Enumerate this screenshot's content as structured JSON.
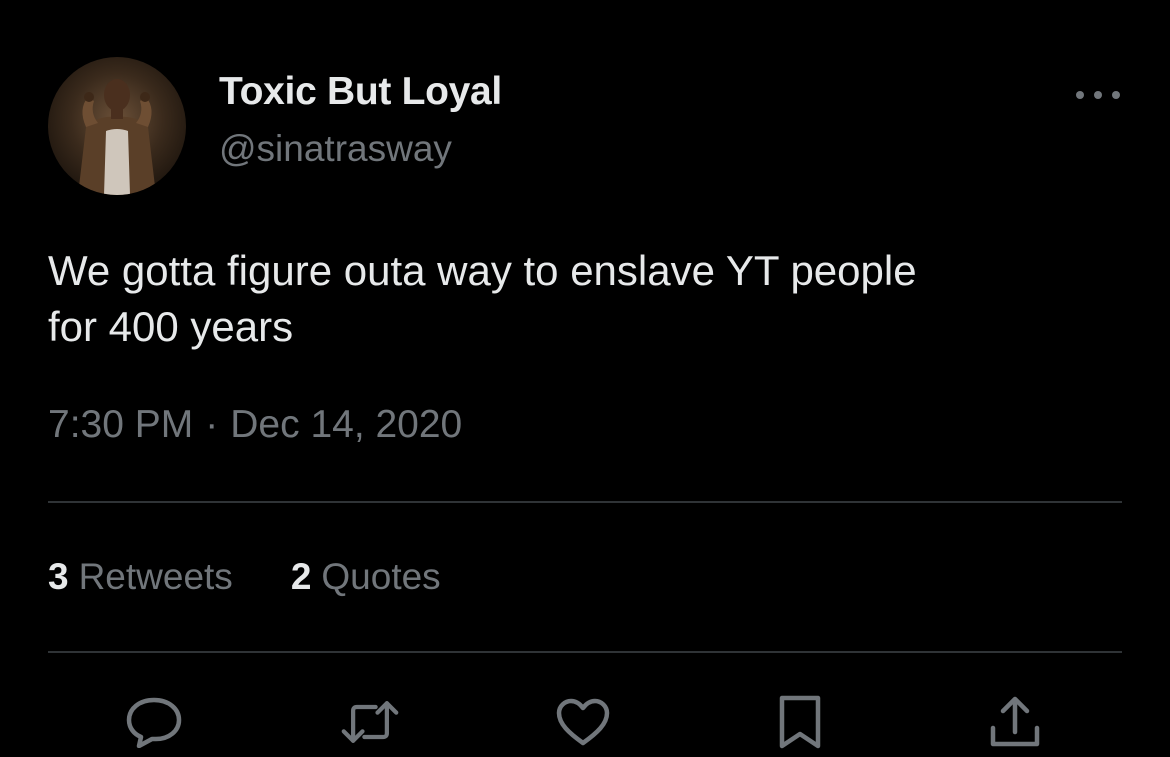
{
  "author": {
    "display_name": "Toxic But Loyal",
    "handle": "@sinatrasway"
  },
  "tweet": {
    "text": "We gotta figure outa way to enslave YT people\nfor 400 years",
    "time": "7:30 PM",
    "separator": "·",
    "date": "Dec 14, 2020"
  },
  "stats": {
    "retweets_count": "3",
    "retweets_label": "Retweets",
    "quotes_count": "2",
    "quotes_label": "Quotes"
  },
  "icons": {
    "more": "more-horizontal-icon",
    "reply": "reply-icon",
    "retweet": "retweet-icon",
    "like": "heart-icon",
    "bookmark": "bookmark-icon",
    "share": "share-icon"
  },
  "colors": {
    "background": "#000000",
    "primary_text": "#e7e9ea",
    "secondary_text": "#71767b",
    "divider": "#2f3336"
  }
}
